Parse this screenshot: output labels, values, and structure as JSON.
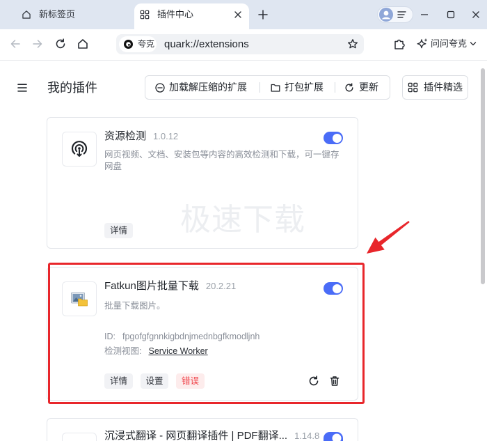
{
  "tabs": [
    {
      "label": "新标签页",
      "icon": "home-icon"
    },
    {
      "label": "插件中心",
      "icon": "grid-icon"
    }
  ],
  "address": {
    "chip": "夸克",
    "url": "quark://extensions"
  },
  "assistant": {
    "label": "问问夸克"
  },
  "page": {
    "title": "我的插件"
  },
  "actions": {
    "load_unpacked": "加载解压缩的扩展",
    "pack": "打包扩展",
    "update": "更新",
    "featured": "插件精选"
  },
  "extensions": [
    {
      "name": "资源检测",
      "version": "1.0.12",
      "enabled": true,
      "description": "网页视频、文档、安装包等内容的高效检测和下载，可一键存网盘",
      "watermark": "极速下载",
      "details": "详情"
    },
    {
      "name": "Fatkun图片批量下载",
      "version": "20.2.21",
      "enabled": true,
      "description": "批量下载图片。",
      "id_label": "ID:",
      "id": "fpgofgfgnnkigbdnjmednbgfkmodljnh",
      "view_label": "检测视图:",
      "view_link": "Service Worker",
      "details": "详情",
      "settings": "设置",
      "errors": "错误"
    },
    {
      "name": "沉浸式翻译 - 网页翻译插件 | PDF翻译...",
      "version": "1.14.8",
      "enabled": true
    }
  ],
  "colors": {
    "accent": "#4a6cf7",
    "error": "#f0454b",
    "error_bg": "#fdecec",
    "annotation": "#e8262b"
  }
}
